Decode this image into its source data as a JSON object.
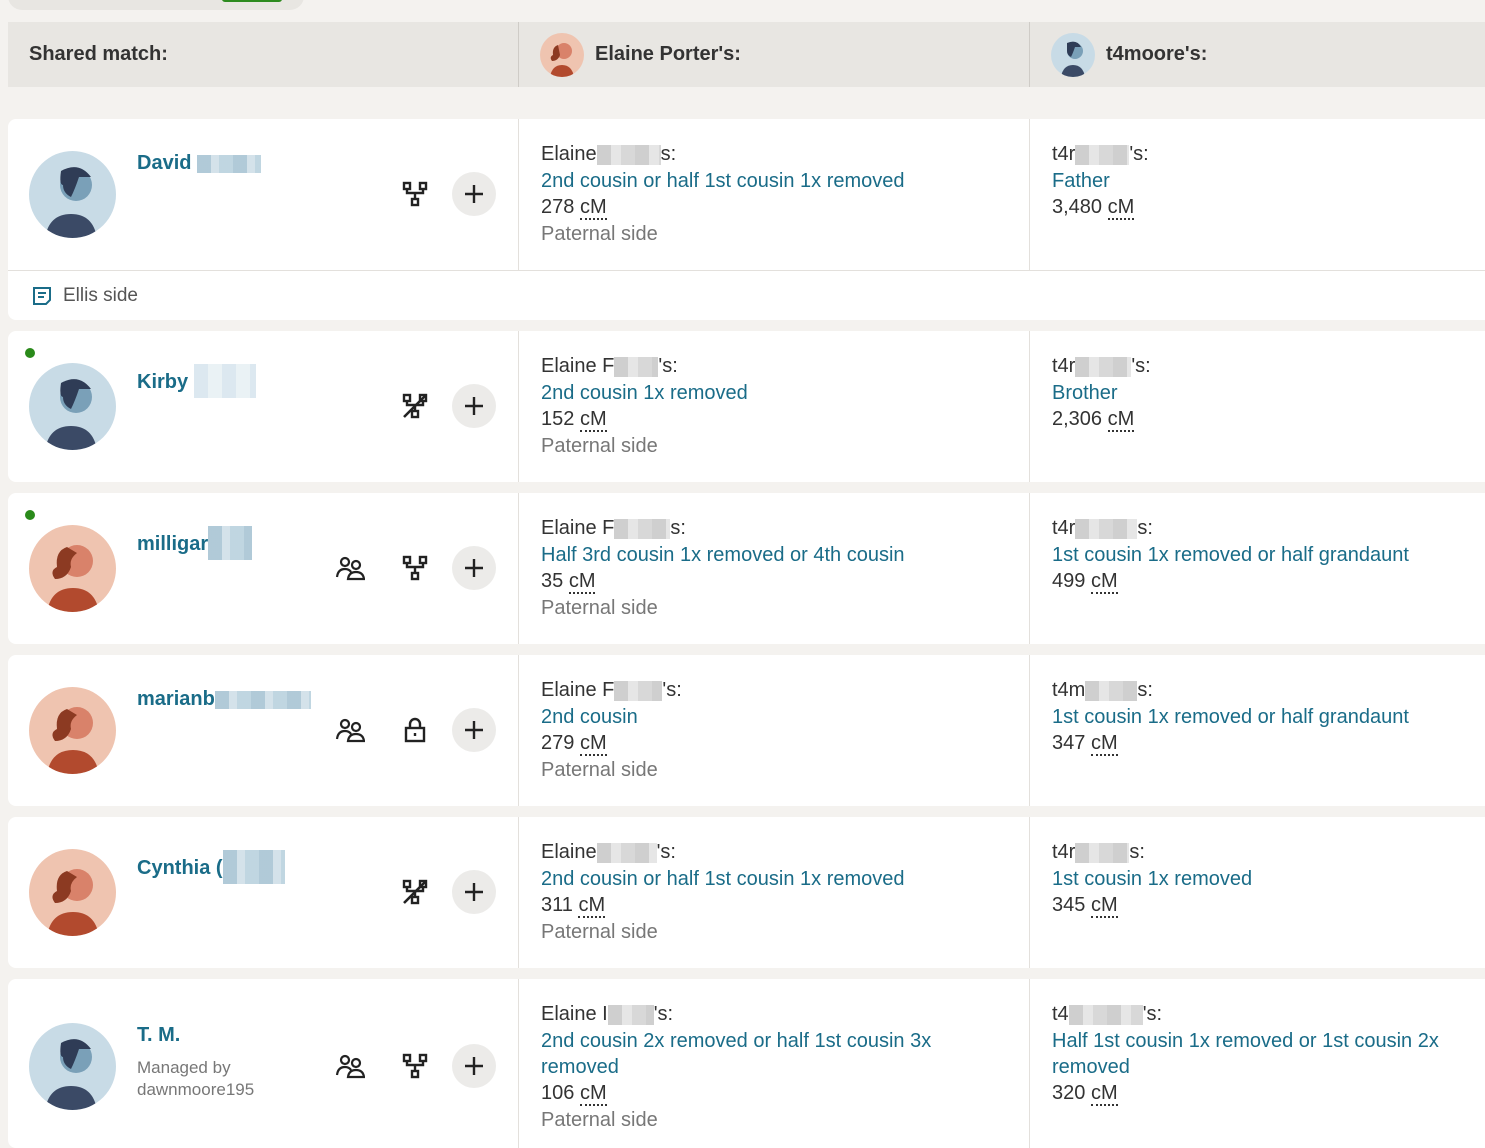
{
  "header": {
    "shared_match": "Shared match:",
    "person_a": "Elaine Porter's:",
    "person_b": "t4moore's:"
  },
  "matches": [
    {
      "name": "David",
      "online": false,
      "avatar": "male-silhouette",
      "icons": [
        "tree-icon"
      ],
      "a_label": "Elaine",
      "a_suffix": "s:",
      "a_relationship": "2nd cousin or half 1st cousin 1x removed",
      "a_cm": "278",
      "a_side": "Paternal side",
      "b_label": "t4r",
      "b_suffix": "'s:",
      "b_relationship": "Father",
      "b_cm": "3,480",
      "note": "Ellis side"
    },
    {
      "name": "Kirby",
      "online": true,
      "avatar": "male-silhouette",
      "icons": [
        "no-tree-icon"
      ],
      "a_label": "Elaine F",
      "a_suffix": "'s:",
      "a_relationship": "2nd cousin 1x removed",
      "a_cm": "152",
      "a_side": "Paternal side",
      "b_label": "t4r",
      "b_suffix": "'s:",
      "b_relationship": "Brother",
      "b_cm": "2,306"
    },
    {
      "name": "milligar",
      "online": true,
      "avatar": "female-silhouette",
      "icons": [
        "shared-people-icon",
        "tree-icon"
      ],
      "a_label": "Elaine F",
      "a_suffix": "s:",
      "a_relationship": "Half 3rd cousin 1x removed or 4th cousin",
      "a_cm": "35",
      "a_side": "Paternal side",
      "b_label": "t4r",
      "b_suffix": "s:",
      "b_relationship": "1st cousin 1x removed or half grandaunt",
      "b_cm": "499"
    },
    {
      "name": "marianb",
      "online": false,
      "avatar": "female-silhouette",
      "icons": [
        "shared-people-icon",
        "lock-icon"
      ],
      "a_label": "Elaine F",
      "a_suffix": "'s:",
      "a_relationship": "2nd cousin",
      "a_cm": "279",
      "a_side": "Paternal side",
      "b_label": "t4m",
      "b_suffix": "s:",
      "b_relationship": "1st cousin 1x removed or half grandaunt",
      "b_cm": "347"
    },
    {
      "name": "Cynthia (",
      "online": false,
      "avatar": "female-silhouette",
      "icons": [
        "no-tree-icon"
      ],
      "a_label": "Elaine",
      "a_suffix": "'s:",
      "a_relationship": "2nd cousin or half 1st cousin 1x removed",
      "a_cm": "311",
      "a_side": "Paternal side",
      "b_label": "t4r",
      "b_suffix": "s:",
      "b_relationship": "1st cousin 1x removed",
      "b_cm": "345"
    },
    {
      "name": "T. M.",
      "online": false,
      "avatar": "male-silhouette",
      "managed": "Managed by dawnmoore195",
      "icons": [
        "shared-people-icon",
        "tree-icon"
      ],
      "a_label": "Elaine I",
      "a_suffix": "'s:",
      "a_relationship": "2nd cousin 2x removed or half 1st cousin 3x removed",
      "a_cm": "106",
      "a_side": "Paternal side",
      "b_label": "t4",
      "b_suffix": "'s:",
      "b_relationship": "Half 1st cousin 1x removed or 1st cousin 2x removed",
      "b_cm": "320"
    }
  ],
  "cm_unit": "cM",
  "add_label": "+"
}
